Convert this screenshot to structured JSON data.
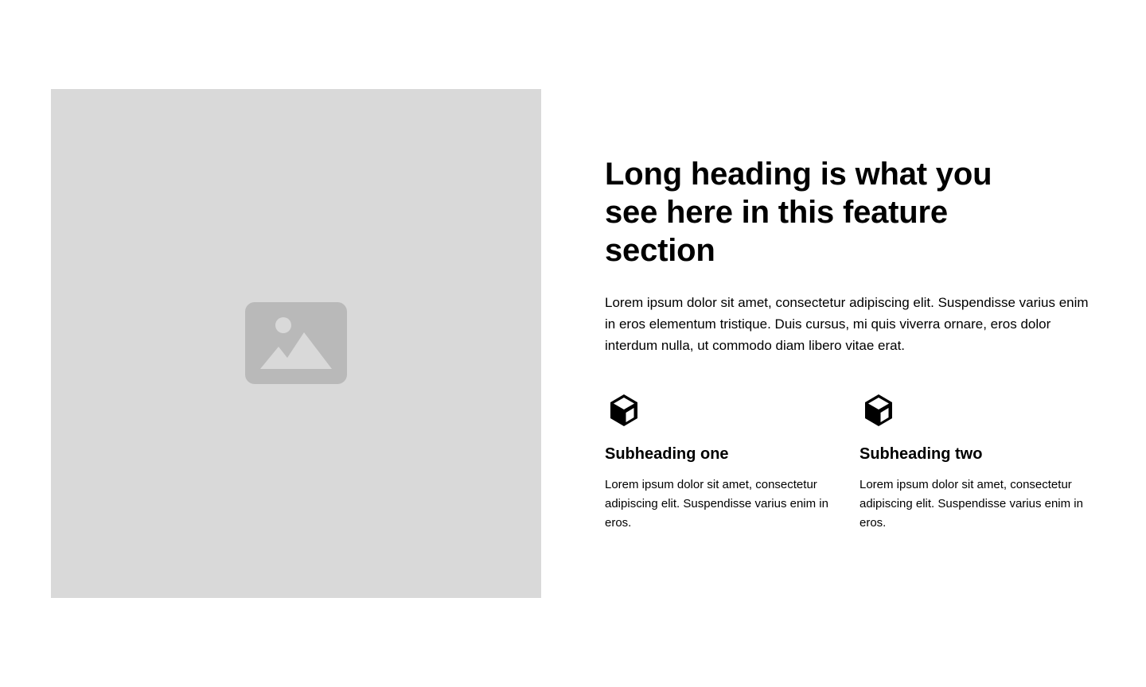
{
  "colors": {
    "background": "#ffffff",
    "image_placeholder": "#d9d9d9",
    "placeholder_icon": "#b9b9b9",
    "text": "#000000"
  },
  "media": {
    "icon": "image-placeholder-icon"
  },
  "content": {
    "heading": "Long heading is what you see here in this feature section",
    "intro": "Lorem ipsum dolor sit amet, consectetur adipiscing elit. Suspendisse varius enim in eros elementum tristique. Duis cursus, mi quis viverra ornare, eros dolor interdum nulla, ut commodo diam libero vitae erat."
  },
  "features": [
    {
      "icon": "cube-icon",
      "title": "Subheading one",
      "text": "Lorem ipsum dolor sit amet, consectetur adipiscing elit. Suspendisse varius enim in eros."
    },
    {
      "icon": "cube-icon",
      "title": "Subheading two",
      "text": "Lorem ipsum dolor sit amet, consectetur adipiscing elit. Suspendisse varius enim in eros."
    }
  ]
}
